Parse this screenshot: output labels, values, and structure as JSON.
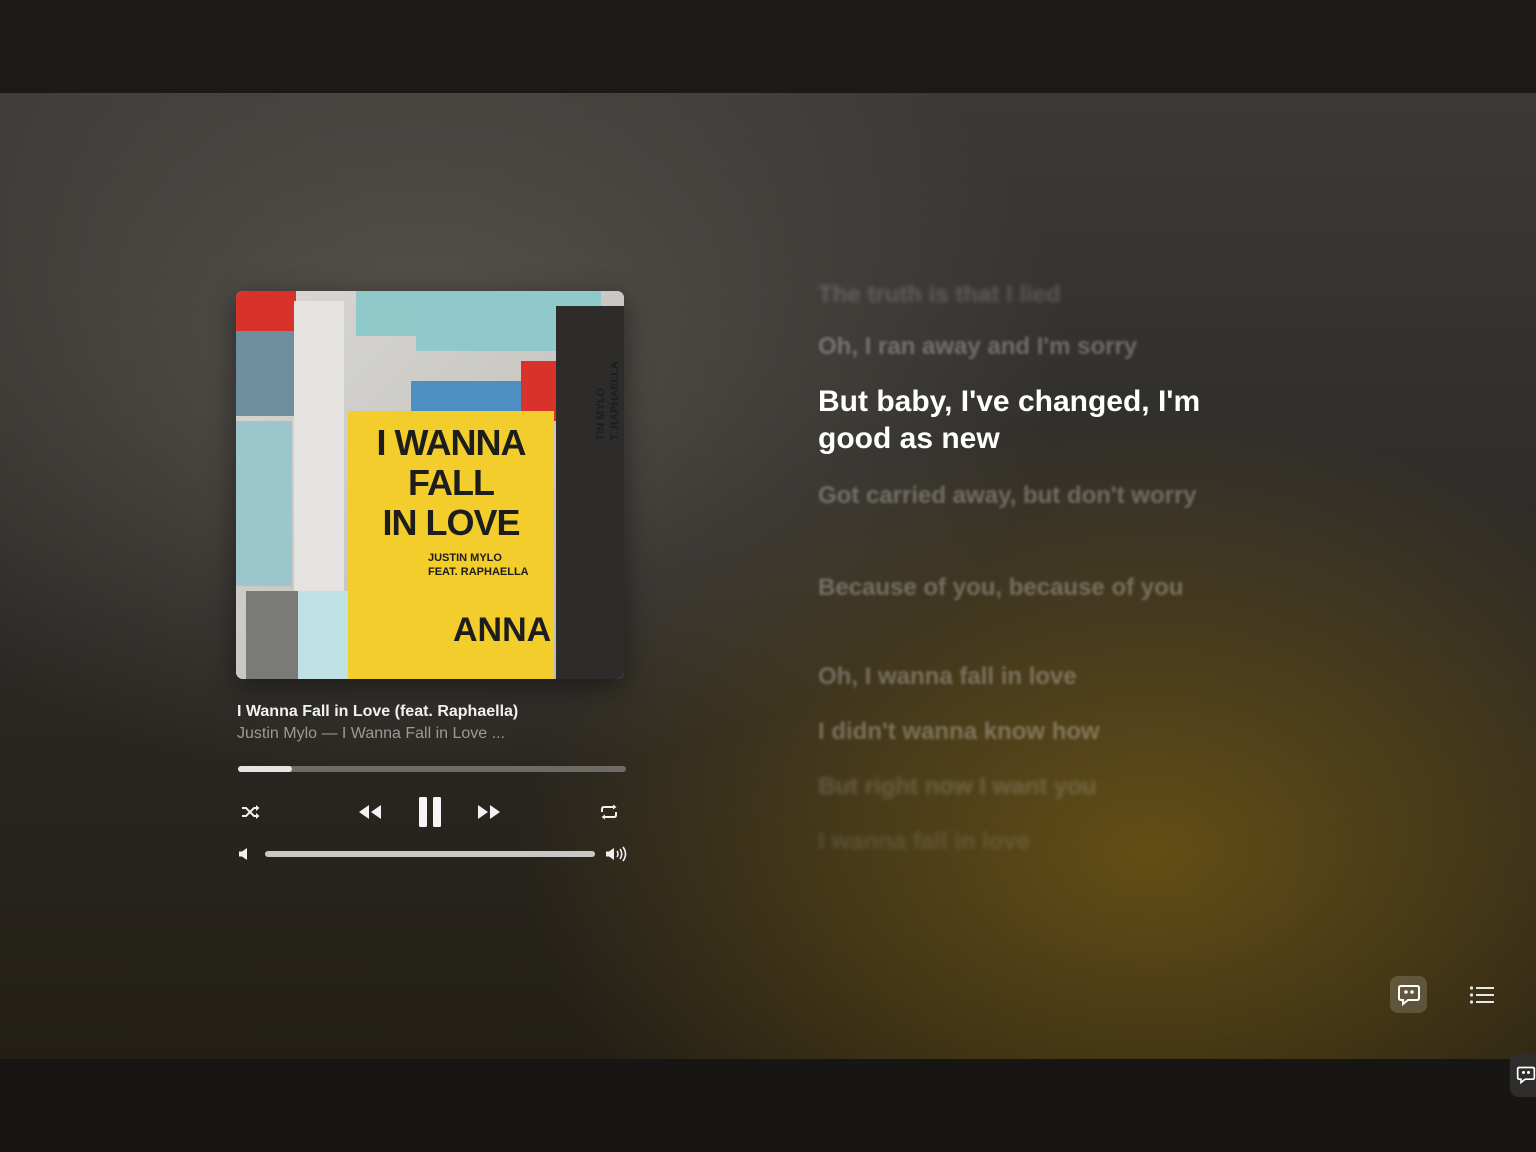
{
  "track": {
    "title": "I Wanna Fall in Love (feat. Raphaella)",
    "subtitle": "Justin Mylo — I Wanna Fall in Love ...",
    "progress": 0.14,
    "volume": 1.0
  },
  "album_art": {
    "poster_lines": [
      "I WANNA",
      "FALL",
      "IN LOVE"
    ],
    "poster_artist": "JUSTIN MYLO",
    "poster_feat": "FEAT. RAPHAELLA",
    "poster_bottom": "ANNA",
    "side_text": "TIN MYLO\nT. RAPHAELLA"
  },
  "controls": {
    "shuffle_icon": "shuffle-icon",
    "previous_icon": "rewind-icon",
    "play_state_icon": "pause-icon",
    "next_icon": "fast-forward-icon",
    "repeat_icon": "repeat-icon",
    "volume_low_icon": "speaker-low-icon",
    "volume_high_icon": "speaker-high-icon"
  },
  "lyrics": {
    "lines": [
      "The truth is that I lied",
      "Oh, I ran away and I'm sorry",
      "But baby, I've changed, I'm good as new",
      "Got carried away, but don't worry",
      "Because of you, because of you",
      "Oh, I wanna fall in love",
      "I didn't wanna know how",
      "But right now I want you",
      "I wanna fall in love"
    ],
    "current_index": 2
  },
  "bottom_actions": {
    "lyrics_icon": "lyrics-quote-icon",
    "queue_icon": "queue-list-icon"
  },
  "colors": {
    "accent_text": "#ffffff",
    "poster_yellow": "#f2cd2b",
    "poster_red": "#d8322b"
  }
}
